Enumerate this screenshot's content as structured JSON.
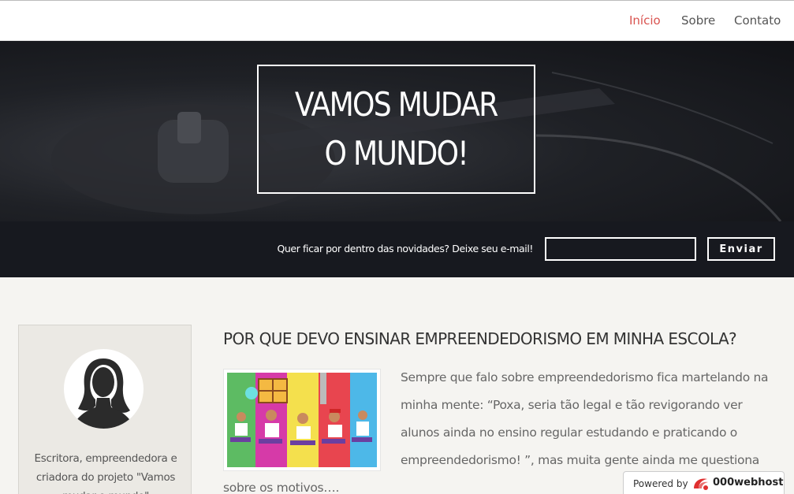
{
  "nav": {
    "items": [
      {
        "label": "Início",
        "active": true
      },
      {
        "label": "Sobre",
        "active": false
      },
      {
        "label": "Contato",
        "active": false
      }
    ],
    "accent_color": "#d9534f"
  },
  "hero": {
    "title_line1": "VAMOS MUDAR",
    "title_line2": "O MUNDO!"
  },
  "newsletter": {
    "label": "Quer ficar por dentro das novidades? Deixe seu e-mail!",
    "email_value": "",
    "send_label": "Enviar"
  },
  "sidebar": {
    "bio": "Escritora, empreendedora e criadora do projeto \"Vamos mudar o mundo\""
  },
  "post": {
    "title": "POR QUE DEVO ENSINAR EMPREENDEDORISMO EM MINHA ESCOLA?",
    "excerpt": "Sempre que falo sobre empreendedorismo fica martelando na minha mente: “Poxa, seria tão legal e tão revigorando ver alunos ainda no ensino regular estudando e praticando o empreendedorismo! ”, mas muita gente ainda me questiona sobre os motivos…."
  },
  "footer_badge": {
    "powered_label": "Powered by",
    "brand": "000webhost"
  }
}
